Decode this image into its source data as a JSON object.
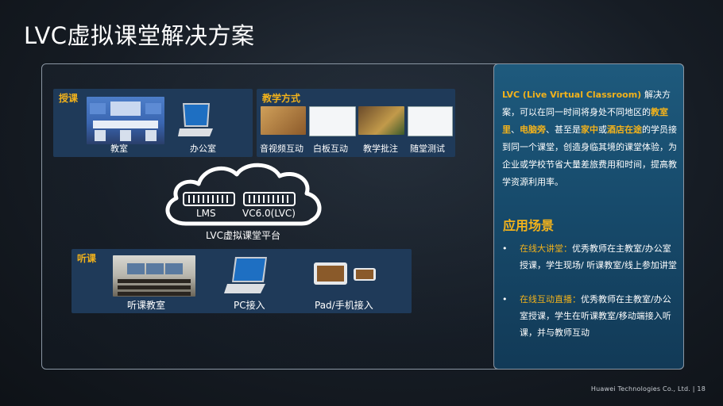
{
  "title": "LVC虚拟课堂解决方案",
  "teach_card": {
    "header": "授课",
    "items": [
      "教室",
      "办公室"
    ]
  },
  "method_card": {
    "header": "教学方式",
    "items": [
      "音视频互动",
      "白板互动",
      "教学批注",
      "随堂测试"
    ]
  },
  "cloud": {
    "left_label": "LMS",
    "right_label": "VC6.0(LVC)",
    "platform": "LVC虚拟课堂平台"
  },
  "listen_card": {
    "header": "听课",
    "items": [
      "听课教室",
      "PC接入",
      "Pad/手机接入"
    ]
  },
  "description": {
    "p1": "LVC (Live Virtual Classroom) ",
    "p2": "解决方案，可以在同一时间将身处不同地区的",
    "h1": "教室里",
    "p3": "、",
    "h2": "电脑旁",
    "p4": "、甚至是",
    "h3": "家中",
    "p5": "或",
    "h4": "酒店在途",
    "p6": "的学员接到同一个课堂，创造身临其境的课堂体验，为企业或学校节省大量差旅费用和时间，提高教学资源利用率。"
  },
  "scenarios": {
    "title": "应用场景",
    "items": [
      {
        "bullet": "•",
        "highlight": "在线大讲堂：",
        "text": "优秀教师在主教室/办公室授课，学生现场/ 听课教室/线上参加讲堂"
      },
      {
        "bullet": "•",
        "highlight": "在线互动直播：",
        "text": "优秀教师在主教室/办公室授课，学生在听课教室/移动端接入听课，并与教师互动"
      }
    ]
  },
  "footer": "Huawei Technologies Co., Ltd.  |   18"
}
